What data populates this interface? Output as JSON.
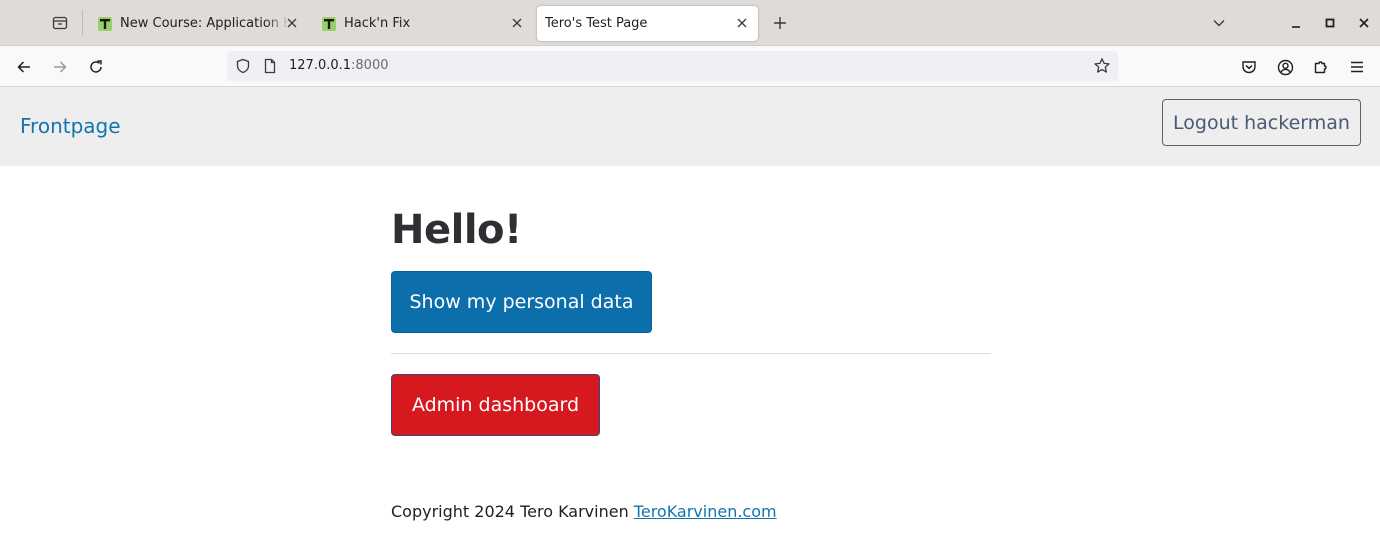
{
  "browser": {
    "tabs": [
      {
        "title": "New Course: Application Hacking",
        "active": false,
        "favicon": "T"
      },
      {
        "title": "Hack'n Fix",
        "active": false,
        "favicon": "T"
      },
      {
        "title": "Tero's Test Page",
        "active": true,
        "favicon": ""
      }
    ],
    "url_host": "127.0.0.1",
    "url_port": ":8000",
    "icons": {
      "tab_tray": "tab-tray-icon",
      "new_tab": "plus-icon",
      "list_tabs": "chevron-down-icon",
      "back": "arrow-left-icon",
      "forward": "arrow-right-icon",
      "reload": "reload-icon",
      "bookmark": "star-icon",
      "pocket": "pocket-icon",
      "account": "account-icon",
      "extensions": "puzzle-icon",
      "menu": "hamburger-icon"
    }
  },
  "header": {
    "home_link": "Frontpage",
    "logout_label": "Logout hackerman"
  },
  "main": {
    "heading": "Hello!",
    "personal_data_button": "Show my personal data",
    "admin_button": "Admin dashboard"
  },
  "footer": {
    "copyright": "Copyright 2024 Tero Karvinen",
    "link_text": "TeroKarvinen.com"
  },
  "colors": {
    "link": "#1276ad",
    "primary_button": "#0c6fab",
    "danger_button": "#d5191f",
    "header_bg": "#eeeeee"
  }
}
